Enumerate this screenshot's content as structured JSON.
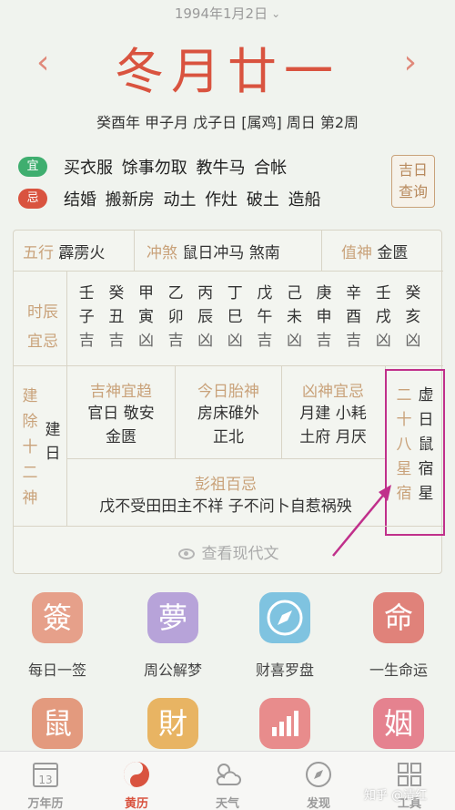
{
  "header": {
    "solar_date": "1994年1月2日",
    "lunar_day": "冬月廿一",
    "ganzhi_line": "癸酉年 甲子月 戊子日 [属鸡] 周日 第2周"
  },
  "yi": {
    "badge": "宜",
    "items": "买衣服 馀事勿取 教牛马 合帐"
  },
  "ji": {
    "badge": "忌",
    "items": "结婚 搬新房 动土 作灶 破土 造船"
  },
  "jiri_query": "吉日查询",
  "card": {
    "wuxing_label": "五行",
    "wuxing_value": "霹雳火",
    "chongsha_label": "冲煞",
    "chongsha_value": "鼠日冲马 煞南",
    "zhishen_label": "值神",
    "zhishen_value": "金匮",
    "shichen_label": "时辰宜忌",
    "hours": [
      {
        "gan": "壬",
        "zhi": "子",
        "ji": "吉"
      },
      {
        "gan": "癸",
        "zhi": "丑",
        "ji": "吉"
      },
      {
        "gan": "甲",
        "zhi": "寅",
        "ji": "凶"
      },
      {
        "gan": "乙",
        "zhi": "卯",
        "ji": "吉"
      },
      {
        "gan": "丙",
        "zhi": "辰",
        "ji": "凶"
      },
      {
        "gan": "丁",
        "zhi": "巳",
        "ji": "凶"
      },
      {
        "gan": "戊",
        "zhi": "午",
        "ji": "吉"
      },
      {
        "gan": "己",
        "zhi": "未",
        "ji": "凶"
      },
      {
        "gan": "庚",
        "zhi": "申",
        "ji": "吉"
      },
      {
        "gan": "辛",
        "zhi": "酉",
        "ji": "吉"
      },
      {
        "gan": "壬",
        "zhi": "戌",
        "ji": "凶"
      },
      {
        "gan": "癸",
        "zhi": "亥",
        "ji": "凶"
      }
    ],
    "jianchu_label": "建除十二神",
    "jianchu_value": "建日",
    "jishen_title": "吉神宜趋",
    "jishen_body": [
      "官日 敬安",
      "金匮"
    ],
    "taishen_title": "今日胎神",
    "taishen_body": [
      "房床碓外",
      "正北"
    ],
    "xiongshen_title": "凶神宜忌",
    "xiongshen_body": [
      "月建 小耗",
      "土府 月厌"
    ],
    "pengzu_title": "彭祖百忌",
    "pengzu_body": "戊不受田田主不祥 子不问卜自惹祸殃",
    "xiu_label": "二十八星宿",
    "xiu_value": "虚日鼠宿星",
    "modern_btn": "查看现代文",
    "highlight_color": "#c0308b"
  },
  "tools_row1": [
    {
      "glyph": "簽",
      "label": "每日一签",
      "color": "#e6a08a",
      "icon": "qian-icon"
    },
    {
      "glyph": "夢",
      "label": "周公解梦",
      "color": "#b7a3d9",
      "icon": "dream-icon"
    },
    {
      "glyph": "",
      "label": "财喜罗盘",
      "color": "#7fc3e0",
      "icon": "compass-icon"
    },
    {
      "glyph": "命",
      "label": "一生命运",
      "color": "#e0827a",
      "icon": "fate-icon"
    }
  ],
  "tools_row2": [
    {
      "glyph": "鼠",
      "color": "#e39a7e",
      "icon": "rat-icon"
    },
    {
      "glyph": "財",
      "color": "#e8b463",
      "icon": "wealth-icon"
    },
    {
      "glyph": "",
      "color": "#e88c8c",
      "icon": "chart-icon"
    },
    {
      "glyph": "姻",
      "color": "#e5828f",
      "icon": "marriage-icon"
    }
  ],
  "tabs": [
    {
      "label": "万年历",
      "icon": "calendar-icon",
      "day": "13"
    },
    {
      "label": "黄历",
      "icon": "yinyang-icon"
    },
    {
      "label": "天气",
      "icon": "weather-icon"
    },
    {
      "label": "发现",
      "icon": "discover-icon"
    },
    {
      "label": "工具",
      "icon": "tools-icon"
    }
  ],
  "watermark": "知乎 @清红"
}
